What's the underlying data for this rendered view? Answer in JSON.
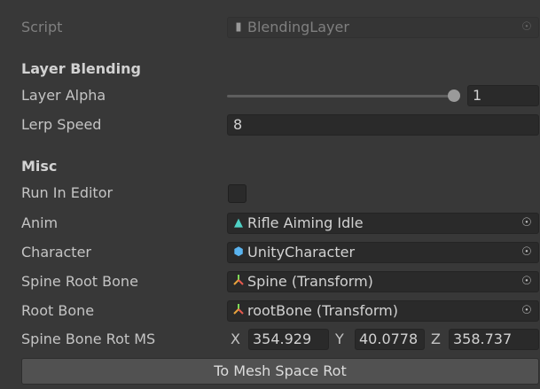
{
  "script_row": {
    "label": "Script",
    "value": "BlendingLayer",
    "icon": "script-file-icon"
  },
  "layer_blending": {
    "header": "Layer Blending",
    "layer_alpha": {
      "label": "Layer Alpha",
      "value": "1",
      "slider_fraction": 1.0
    },
    "lerp_speed": {
      "label": "Lerp Speed",
      "value": "8"
    }
  },
  "misc": {
    "header": "Misc",
    "run_in_editor": {
      "label": "Run In Editor",
      "checked": false
    },
    "anim": {
      "label": "Anim",
      "value": "Rifle Aiming Idle",
      "icon": "animation-clip-icon"
    },
    "character": {
      "label": "Character",
      "value": "UnityCharacter",
      "icon": "prefab-cube-icon"
    },
    "spine_root_bone": {
      "label": "Spine Root Bone",
      "value": "Spine (Transform)",
      "icon": "transform-icon"
    },
    "root_bone": {
      "label": "Root Bone",
      "value": "rootBone (Transform)",
      "icon": "transform-icon"
    },
    "spine_bone_rot_ms": {
      "label": "Spine Bone Rot MS",
      "x_label": "X",
      "x": "354.929",
      "y_label": "Y",
      "y": "40.0778",
      "z_label": "Z",
      "z": "358.737"
    }
  },
  "button": {
    "label": "To Mesh Space Rot"
  },
  "colors": {
    "panel": "#383838",
    "field": "#2a2a2a",
    "button": "#515151",
    "text": "#c4c4c4"
  }
}
